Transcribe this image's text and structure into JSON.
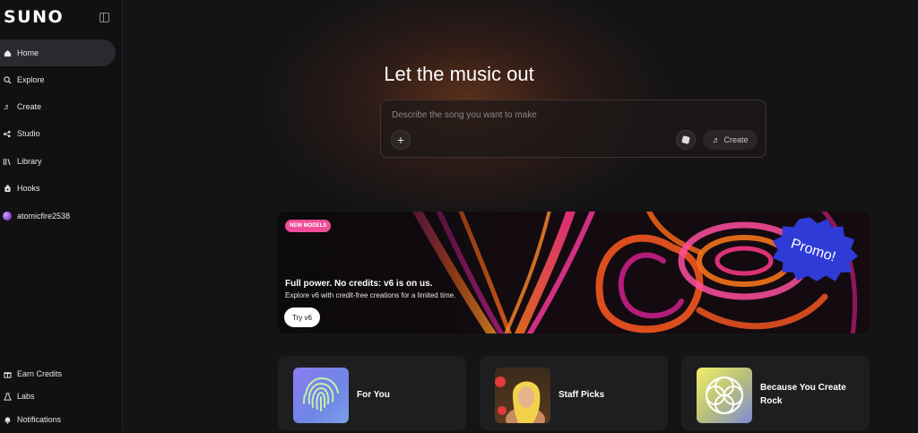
{
  "app": {
    "logo_text": "SUNO"
  },
  "sidebar": {
    "items": [
      {
        "label": "Home",
        "icon": "home-icon"
      },
      {
        "label": "Explore",
        "icon": "search-icon"
      },
      {
        "label": "Create",
        "icon": "music-note-icon"
      },
      {
        "label": "Studio",
        "icon": "studio-icon"
      },
      {
        "label": "Library",
        "icon": "library-icon"
      },
      {
        "label": "Hooks",
        "icon": "hooks-icon"
      },
      {
        "label": "atomicfire2538",
        "icon": "avatar"
      }
    ],
    "bottom_items": [
      {
        "label": "Earn Credits",
        "icon": "gift-icon"
      },
      {
        "label": "Labs",
        "icon": "flask-icon"
      },
      {
        "label": "Notifications",
        "icon": "bell-icon"
      }
    ],
    "active": "Home"
  },
  "hero": {
    "title": "Let the music out",
    "prompt_placeholder": "Describe the song you want to make",
    "create_label": "Create"
  },
  "banner": {
    "badge": "NEW MODELS",
    "headline": "Full power. No credits: v6 is on us.",
    "subtext": "Explore v6 with credit-free creations for a limited time.",
    "cta": "Try v6",
    "promo_text": "Promo!",
    "art_text": "V6"
  },
  "cards": [
    {
      "title_line1": "For You",
      "title_line2": ""
    },
    {
      "title_line1": "Staff Picks",
      "title_line2": ""
    },
    {
      "title_line1": "Because You Create",
      "title_line2": "Rock"
    }
  ],
  "colors": {
    "background": "#141416",
    "sidebar": "#111113",
    "badge": "#ef4d9a",
    "promo": "#2f3bd6"
  }
}
